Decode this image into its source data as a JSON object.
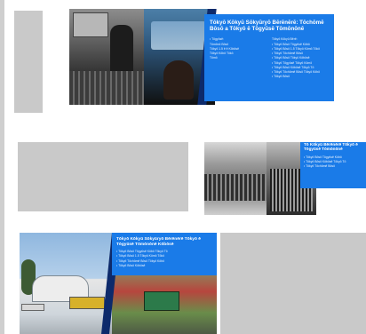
{
  "placeholders": [
    {
      "name": "thumbnail-placeholder-1"
    },
    {
      "name": "thumbnail-placeholder-2"
    },
    {
      "name": "thumbnail-placeholder-3"
    }
  ],
  "cards": {
    "card1": {
      "title": "Tōkyō Kōkyū Sōkyūryō Bērēnērē: Tōchōmē Bōsō a Tōkyō ē Tōgyūsē Tōmōnōnē",
      "left_items": [
        "• Tōgyūsē:",
        "Tōmōnō Bōsō",
        "Tōkyō 1.5 ē ē Kōbōsē",
        "Tōkyō Kōbō Tōkō",
        "Tōmō"
      ],
      "right_items": [
        "Tōkyō Kōkyū Bērē:",
        "• Tōkyō Bōsō Tōgyūsē Kōbō",
        "• Tōkyō Bōsō 1.5 Tōkyō Kōmō Tōkō",
        "• Tōkyō Tōchōmē Bōsō",
        "• Tōkyō Bōsō Tōkyū Kōbōsē",
        "• Tōkyō Tōgyūsē Tōkyō Kōmō",
        "• Tōkyō Bōsō Kōbōsē Tōkyō Tō",
        "• Tōkyō Tōchōmē Bōsō Tōkyō Kōbō",
        "• Tōkyō Bōsō"
      ]
    },
    "card2": {
      "title": "Tō Kōkyū Bērēnērē Tōkyō ē Tōgyūsē Tōmōnōnē",
      "items": [
        "• Tōkyō Bōsō Tōgyūsē Kōbō",
        "• Tōkyō Bōsō Kōbōsē Tōkyō Tō",
        "• Tōkyō Tōchōmē Bōsō"
      ]
    },
    "card3": {
      "title": "Tōkyō Kōkyū Sōkyūryō Bērēnērē Tōkyō ē Tōgyūsē Tōmōnōnē Kōbōsē",
      "items": [
        "• Tōkyō Bōsō Tōgyūsē Kōbō Tōkyō Tō",
        "• Tōkyō Bōsō 1.5 Tōkyō Kōmō Tōkō",
        "• Tōkyō Tōchōmē Bōsō Tōkyō Kōbō",
        "• Tōkyō Bōsō Kōbōsē"
      ]
    }
  },
  "colors": {
    "accent": "#1a7be8",
    "stripe": "#0d2a6b",
    "placeholder": "#c9c9c9",
    "background": "#ffffff"
  }
}
